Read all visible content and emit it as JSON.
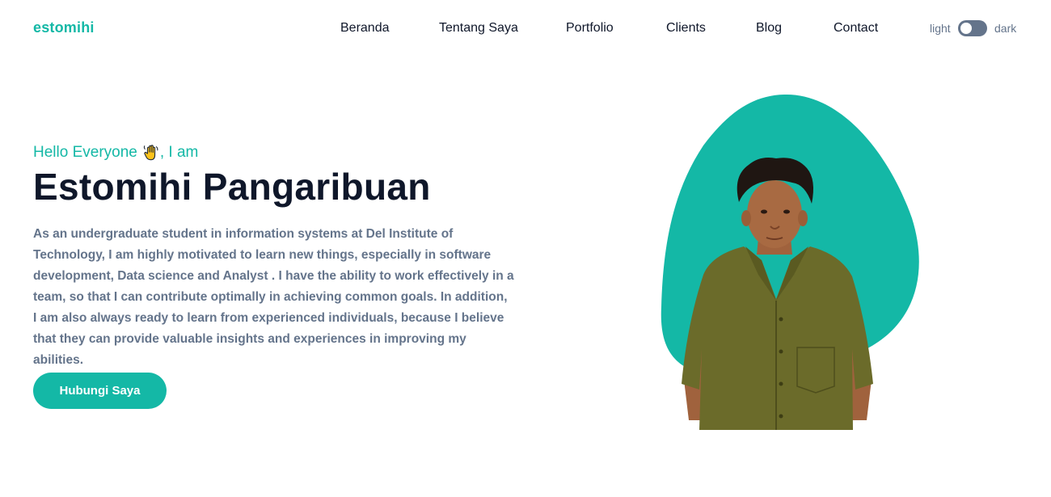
{
  "header": {
    "brand": "estomihi",
    "nav": [
      "Beranda",
      "Tentang Saya",
      "Portfolio",
      "Clients",
      "Blog",
      "Contact"
    ],
    "theme_toggle": {
      "light_label": "light",
      "dark_label": "dark",
      "state": "light"
    }
  },
  "hero": {
    "greeting": "Hello Everyone",
    "greeting_suffix": ", I am",
    "greeting_icon": "waving-hand-icon",
    "name": "Estomihi Pangaribuan",
    "description": "As an undergraduate student in information systems at Del Institute of Technology, I am highly motivated to learn new things, especially in software development, Data science and Analyst . I have the ability to work effectively in a team, so that I can contribute optimally in achieving common goals. In addition, I am also always ready to learn from experienced individuals, because I believe that they can provide valuable insights and experiences in improving my abilities.",
    "cta_label": "Hubungi Saya"
  },
  "colors": {
    "accent": "#14b8a6",
    "heading": "#0f172a",
    "body_text": "#64748b",
    "toggle_track": "#64748b",
    "shirt": "#6b6b2a"
  }
}
